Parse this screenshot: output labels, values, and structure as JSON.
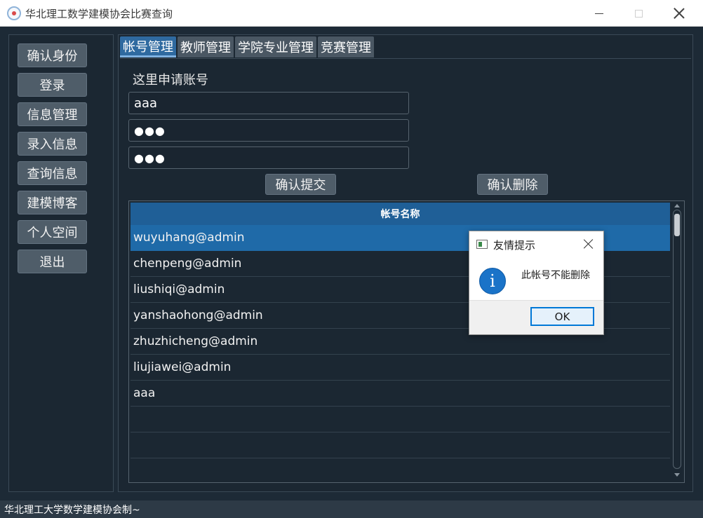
{
  "window": {
    "title": "华北理工数学建模协会比赛查询",
    "app_icon": "app-logo-icon"
  },
  "sidebar": {
    "items": [
      {
        "label": "确认身份"
      },
      {
        "label": "登录"
      },
      {
        "label": "信息管理"
      },
      {
        "label": "录入信息"
      },
      {
        "label": "查询信息"
      },
      {
        "label": "建模博客"
      },
      {
        "label": "个人空间"
      },
      {
        "label": "退出"
      }
    ]
  },
  "tabs": [
    {
      "label": "帐号管理",
      "active": true
    },
    {
      "label": "教师管理",
      "active": false
    },
    {
      "label": "学院专业管理",
      "active": false
    },
    {
      "label": "竞赛管理",
      "active": false
    }
  ],
  "account_form": {
    "heading": "这里申请账号",
    "username_value": "aaa",
    "password_value": "●●●",
    "confirm_password_value": "●●●",
    "submit_label": "确认提交",
    "delete_label": "确认删除"
  },
  "account_table": {
    "header": "帐号名称",
    "rows": [
      "wuyuhang@admin",
      "chenpeng@admin",
      "liushiqi@admin",
      "yanshaohong@admin",
      "zhuzhicheng@admin",
      "liujiawei@admin",
      "aaa"
    ],
    "selected_row": 0
  },
  "status_bar": {
    "text": "华北理工大学数学建模协会制~"
  },
  "dialog": {
    "title": "友情提示",
    "message": "此帐号不能删除",
    "ok_label": "OK",
    "icon": "info-icon",
    "info_glyph": "i"
  },
  "colors": {
    "background": "#1d2a36",
    "accent": "#1f6aa8",
    "button": "#4f5d69"
  }
}
